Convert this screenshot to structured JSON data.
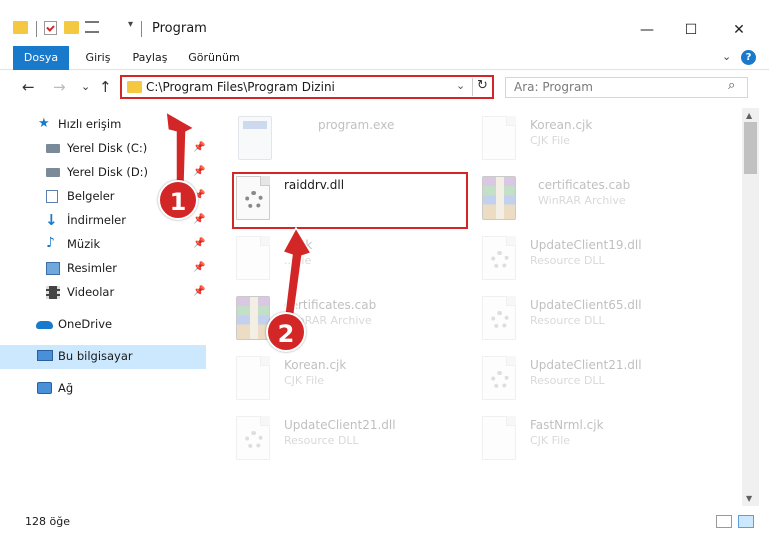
{
  "window": {
    "title": "Program",
    "minimize": "—",
    "maximize": "☐",
    "close": "✕"
  },
  "ribbon": {
    "tabs": [
      "Dosya",
      "Giriş",
      "Paylaş",
      "Görünüm"
    ],
    "expand": "⌄",
    "help": "?"
  },
  "nav": {
    "back": "←",
    "forward": "→",
    "recent": "⌄",
    "up": "↑",
    "address": "C:\\Program Files\\Program Dizini",
    "address_dropdown": "⌄",
    "refresh": "↻",
    "search_placeholder": "Ara: Program",
    "search_icon": "⌕"
  },
  "sidebar": {
    "items": [
      {
        "label": "Hızlı erişim",
        "icon": "star-icon",
        "pinned": false
      },
      {
        "label": "Yerel Disk (C:)",
        "icon": "drive-icon",
        "pinned": true
      },
      {
        "label": "Yerel Disk (D:)",
        "icon": "drive-icon",
        "pinned": true
      },
      {
        "label": "Belgeler",
        "icon": "documents-icon",
        "pinned": true
      },
      {
        "label": "İndirmeler",
        "icon": "download-icon",
        "pinned": true
      },
      {
        "label": "Müzik",
        "icon": "music-icon",
        "pinned": true
      },
      {
        "label": "Resimler",
        "icon": "pictures-icon",
        "pinned": true
      },
      {
        "label": "Videolar",
        "icon": "video-icon",
        "pinned": true
      },
      {
        "label": "OneDrive",
        "icon": "cloud-icon",
        "pinned": false
      },
      {
        "label": "Bu bilgisayar",
        "icon": "computer-icon",
        "pinned": false
      },
      {
        "label": "Ağ",
        "icon": "network-icon",
        "pinned": false
      }
    ],
    "pin_glyph": "📌"
  },
  "files": {
    "left": [
      {
        "name": "program.exe",
        "type": "",
        "icon": "exe-icon"
      },
      {
        "name": "raiddrv.dll",
        "type": "",
        "icon": "dll-icon"
      },
      {
        "name": "...cjk",
        "type": "...file",
        "icon": "document-icon"
      },
      {
        "name": "certificates.cab",
        "type": "WinRAR Archive",
        "icon": "rar-icon"
      },
      {
        "name": "Korean.cjk",
        "type": "CJK File",
        "icon": "document-icon"
      },
      {
        "name": "UpdateClient21.dll",
        "type": "Resource DLL",
        "icon": "dll-icon"
      }
    ],
    "right": [
      {
        "name": "Korean.cjk",
        "type": "CJK File",
        "icon": "document-icon"
      },
      {
        "name": "certificates.cab",
        "type": "WinRAR Archive",
        "icon": "rar-icon"
      },
      {
        "name": "UpdateClient19.dll",
        "type": "Resource DLL",
        "icon": "dll-icon"
      },
      {
        "name": "UpdateClient65.dll",
        "type": "Resource DLL",
        "icon": "dll-icon"
      },
      {
        "name": "UpdateClient21.dll",
        "type": "Resource DLL",
        "icon": "dll-icon"
      },
      {
        "name": "FastNrml.cjk",
        "type": "CJK File",
        "icon": "document-icon"
      }
    ]
  },
  "status": {
    "item_count": "128 öğe"
  },
  "callouts": [
    "1",
    "2"
  ],
  "colors": {
    "accent": "#1979ca",
    "highlight": "#d32727",
    "selected": "#cce8ff"
  }
}
